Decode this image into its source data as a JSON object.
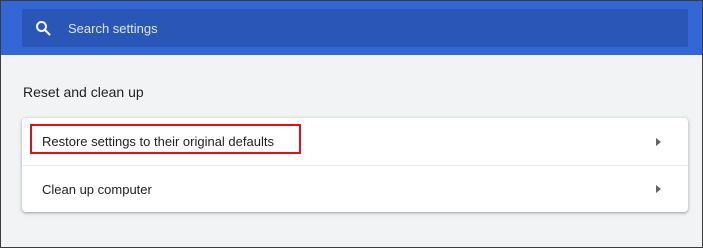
{
  "search": {
    "placeholder": "Search settings",
    "icon": "search-icon"
  },
  "section": {
    "title": "Reset and clean up"
  },
  "items": [
    {
      "label": "Restore settings to their original defaults",
      "icon": "arrow-right-icon"
    },
    {
      "label": "Clean up computer",
      "icon": "arrow-right-icon"
    }
  ],
  "colors": {
    "header": "#3367d6",
    "search_box": "#2a56b8",
    "background": "#f1f3f4",
    "highlight": "#e0111b"
  }
}
